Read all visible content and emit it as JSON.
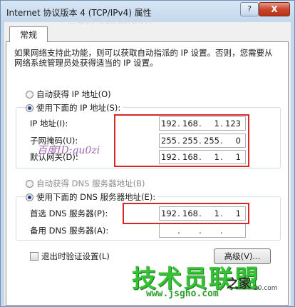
{
  "window": {
    "title": "Internet 协议版本 4 (TCP/IPv4) 属性",
    "help": "?",
    "close": "X"
  },
  "tab": "常规",
  "description": "如果网络支持此功能，则可以获取自动指派的 IP 设置。否则，您需要从网络系统管理员处获得适当的 IP 设置。",
  "ip_section": {
    "auto_label": "自动获得 IP 地址(O)",
    "manual_label": "使用下面的 IP 地址(S):",
    "selected": "manual",
    "ip_label": "IP 地址(I):",
    "mask_label": "子网掩码(U):",
    "gateway_label": "默认网关(D):",
    "ip": [
      "192",
      "168",
      "1",
      "123"
    ],
    "mask": [
      "255",
      "255",
      "255",
      "0"
    ],
    "gateway": [
      "192",
      "168",
      "1",
      "1"
    ]
  },
  "dns_section": {
    "auto_label": "自动获得 DNS 服务器地址(B)",
    "manual_label": "使用下面的 DNS 服务器地址(E):",
    "selected": "manual",
    "preferred_label": "首选 DNS 服务器(P):",
    "alternate_label": "备用 DNS 服务器(A):",
    "preferred": [
      "192",
      "168",
      "1",
      "1"
    ],
    "alternate": [
      "",
      "",
      "",
      ""
    ]
  },
  "validate_label": "退出时验证设置(L)",
  "advanced_label": "高级(V)...",
  "watermarks": {
    "top": "三联网 3LIAN.COM",
    "mid": "百度ID:qu0zi",
    "brand": "技术员联盟",
    "site": "www.jsgho.com",
    "site2": "之家",
    "site3": "20.com"
  },
  "colors": {
    "highlight_box": "#d62828",
    "brand_green": "#35c235"
  }
}
